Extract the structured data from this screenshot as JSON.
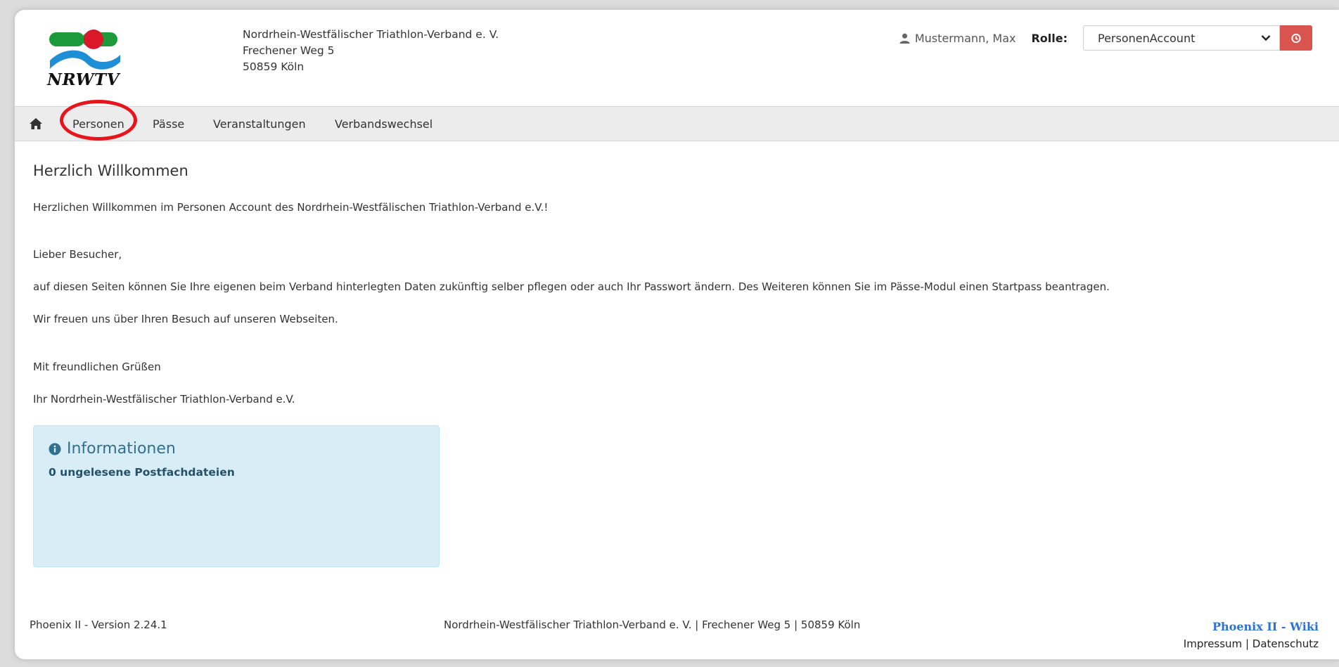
{
  "header": {
    "logo_text": "NRWTV",
    "address": [
      "Nordrhein-Westfälischer Triathlon-Verband e. V.",
      "Frechener Weg 5",
      "50859 Köln"
    ],
    "user_name": "Mustermann, Max",
    "role_label": "Rolle:",
    "role_value": "PersonenAccount"
  },
  "nav": {
    "items": [
      {
        "label": "Personen"
      },
      {
        "label": "Pässe"
      },
      {
        "label": "Veranstaltungen"
      },
      {
        "label": "Verbandswechsel"
      }
    ]
  },
  "content": {
    "title": "Herzlich Willkommen",
    "paragraphs": [
      "Herzlichen Willkommen im Personen Account des Nordrhein-Westfälischen Triathlon-Verband e.V.!",
      "Lieber Besucher,",
      "auf diesen Seiten können Sie Ihre eigenen beim Verband hinterlegten Daten zukünftig selber pflegen oder auch Ihr Passwort ändern. Des Weiteren können Sie im Pässe-Modul einen Startpass beantragen.",
      "Wir freuen uns über Ihren Besuch auf unseren Webseiten.",
      "Mit freundlichen Grüßen",
      "Ihr Nordrhein-Westfälischer Triathlon-Verband e.V."
    ]
  },
  "info": {
    "title": "Informationen",
    "text": "0 ungelesene Postfachdateien"
  },
  "footer": {
    "version": "Phoenix II - Version 2.24.1",
    "center": "Nordrhein-Westfälischer Triathlon-Verband e. V. | Frechener Weg 5 | 50859 Köln",
    "wiki": "Phoenix II - Wiki",
    "impressum": "Impressum",
    "separator": "|",
    "datenschutz": "Datenschutz"
  },
  "colors": {
    "accent_red": "#d9534f",
    "annotation_red": "#e8141b",
    "info_bg": "#d9edf7",
    "info_text": "#31708f",
    "link_blue": "#2a72d6",
    "logo_green": "#1a9a3a",
    "logo_blue": "#1e8fd6"
  },
  "icons": {
    "home": "home-icon",
    "user": "user-icon",
    "dropdown": "chevron-down-icon",
    "logout": "power-icon",
    "info": "info-circle-icon"
  }
}
